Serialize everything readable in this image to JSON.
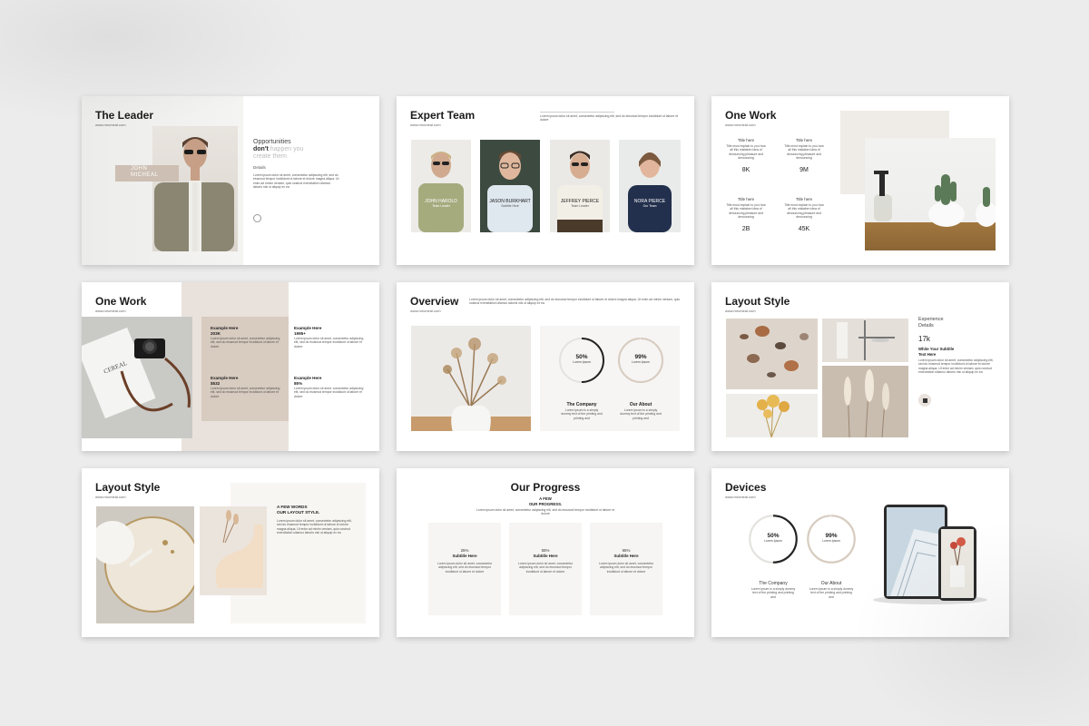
{
  "colors": {
    "background": "#ececec",
    "slide": "#ffffff",
    "beige": "#d9ccc2",
    "sand": "#efebe7",
    "text_dark": "#1b1b1b"
  },
  "lorem_long": "Lorem ipsum dolor sit amet, consectetur adipiscing elit, sed do eiusmod tempor incididunt ut labore et dolore magna aliqua. Ut enim ad minim veniam, quis nostrud exercitation ullamco laboris nisi ut aliquip ex ea",
  "lorem_short": "Lorem ipsum dolor sit amet, consectetur adipiscing elit, sed do eiusmod tempor incididunt ut labore et dolore",
  "site_url": "www.mrcmeal.com",
  "slide1": {
    "title": "The Leader",
    "name_line1": "JOHN",
    "name_line2": "MICHEAL",
    "headline_1": "Opportunities",
    "headline_2_bold": "don't",
    "headline_2_rest": " happen you",
    "headline_3": "create them",
    "details_label": "Details",
    "logo_icon": "circle-logo-icon"
  },
  "slide2": {
    "title": "Expert Team",
    "members": [
      {
        "name": "JOHN HAROLD",
        "role": "Team Leader"
      },
      {
        "name": "JASON BURKHART",
        "role": "Subtitle Here"
      },
      {
        "name": "JEFFREY PIERCE",
        "role": "Team Leader"
      },
      {
        "name": "NORA PIERCE",
        "role": "Our Team"
      }
    ]
  },
  "slide3": {
    "title": "One Work",
    "stats": [
      {
        "label": "Title here",
        "value": "8K"
      },
      {
        "label": "Title here",
        "value": "9M"
      },
      {
        "label": "Title here",
        "value": "2B"
      },
      {
        "label": "Title here",
        "value": "45K"
      }
    ],
    "stat_text": "Title must explain to you how all this mistaken idea of denouncing pleasure and denouncing"
  },
  "slide4": {
    "title": "One Work",
    "examples": [
      {
        "label": "Example Here",
        "value": "203K"
      },
      {
        "label": "Example Here",
        "value": "1995+"
      },
      {
        "label": "Example Here",
        "value": "$532"
      },
      {
        "label": "Example Here",
        "value": "85%"
      }
    ],
    "camera_label": "CEREAL"
  },
  "slide5": {
    "title": "Overview",
    "rings": [
      {
        "value": "50%",
        "caption": "Lorem Ipsum",
        "title": "The Company",
        "text": "Lorem ipsum is a simply dummy text of the printing and printing and",
        "fraction": 0.5
      },
      {
        "value": "99%",
        "caption": "Lorem Ipsum",
        "title": "Our About",
        "text": "Lorem ipsum is a simply dummy text of the printing and printing and",
        "fraction": 0.99
      }
    ]
  },
  "slide6": {
    "title": "Layout Style",
    "experience_1": "Experience",
    "experience_2": "Details",
    "value": "17k",
    "subtitle_1": "White Your Subtitle",
    "subtitle_2": "Text Here",
    "badge_icon": "square-link-icon"
  },
  "slide7": {
    "title": "Layout Style",
    "heading_1": "A FEW WORDS",
    "heading_2": "OUR LAYOUT STYLE."
  },
  "slide8": {
    "title": "Our Progress",
    "heading_1": "A FEW",
    "heading_2": "OUR PROGRESS.",
    "cards": [
      {
        "value": "25%",
        "label": "Subtitle Here"
      },
      {
        "value": "55%",
        "label": "Subtitle Here"
      },
      {
        "value": "65%",
        "label": "Subtitle Here"
      }
    ]
  },
  "slide9": {
    "title": "Devices",
    "rings": [
      {
        "value": "50%",
        "caption": "Lorem Ipsum",
        "title": "The Company",
        "text": "Lorem ipsum is a simply dummy text of the printing and printing and",
        "fraction": 0.5
      },
      {
        "value": "99%",
        "caption": "Lorem Ipsum",
        "title": "Our About",
        "text": "Lorem ipsum is a simply dummy text of the printing and printing and",
        "fraction": 0.99
      }
    ]
  }
}
